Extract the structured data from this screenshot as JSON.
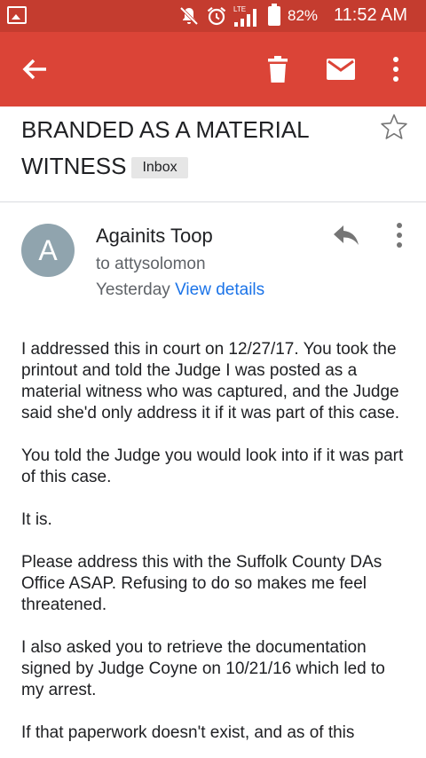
{
  "status_bar": {
    "battery": "82%",
    "time": "11:52 AM"
  },
  "email": {
    "subject": "BRANDED AS A MATERIAL WITNESS",
    "label": "Inbox",
    "sender": {
      "initial": "A",
      "name": "Againits Toop",
      "recipient": "to attysolomon",
      "date": "Yesterday",
      "details_link": "View details"
    },
    "body": [
      "I addressed this in court on 12/27/17. You took the printout and told the Judge I was posted as a material witness who was captured, and the Judge said she'd only address it if it was part of this case.",
      "You told the Judge you would look into if it was part of this case.",
      "It is.",
      "Please address this with the Suffolk County DAs Office ASAP. Refusing to do so makes me feel threatened.",
      "I also asked you to retrieve the documentation signed by Judge Coyne on 10/21/16 which led to my arrest.",
      "If that paperwork doesn't exist, and as of this"
    ]
  },
  "colors": {
    "status_bar": "#c43c2f",
    "app_bar": "#db4437",
    "avatar": "#90a4ae",
    "link": "#1a73e8"
  },
  "icons": {
    "status_bar": [
      "gallery-icon",
      "mute-icon",
      "alarm-icon",
      "lte-signal-icon",
      "battery-icon"
    ],
    "app_bar": [
      "back-arrow-icon",
      "trash-icon",
      "mail-icon",
      "more-vert-icon"
    ],
    "message": [
      "star-icon",
      "reply-icon",
      "more-vert-icon"
    ]
  }
}
